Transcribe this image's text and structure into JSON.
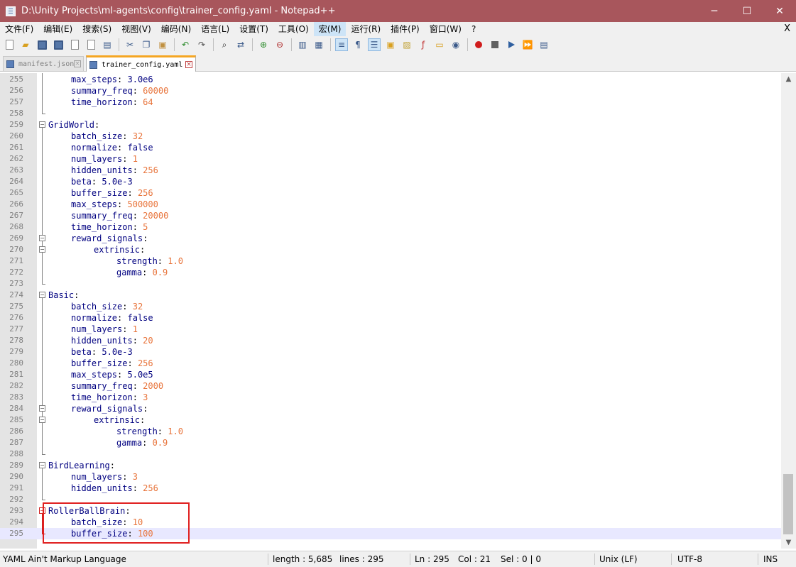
{
  "window": {
    "title": "D:\\Unity Projects\\ml-agents\\config\\trainer_config.yaml - Notepad++",
    "minimize": "─",
    "maximize": "☐",
    "close": "✕"
  },
  "menu": {
    "items": [
      "文件(F)",
      "编辑(E)",
      "搜索(S)",
      "视图(V)",
      "编码(N)",
      "语言(L)",
      "设置(T)",
      "工具(O)",
      "宏(M)",
      "运行(R)",
      "插件(P)",
      "窗口(W)",
      "?"
    ],
    "close_doc": "X"
  },
  "tabs": [
    {
      "label": "manifest.json",
      "active": false
    },
    {
      "label": "trainer_config.yaml",
      "active": true
    }
  ],
  "editor": {
    "lines": [
      {
        "n": "255",
        "indent": 1,
        "key": "max_steps",
        "val": "3.0e6",
        "vcolor": "key"
      },
      {
        "n": "256",
        "indent": 1,
        "key": "summary_freq",
        "val": "60000"
      },
      {
        "n": "257",
        "indent": 1,
        "key": "time_horizon",
        "val": "64"
      },
      {
        "n": "258",
        "indent": 0,
        "key": "",
        "val": ""
      },
      {
        "n": "259",
        "indent": 0,
        "key": "GridWorld",
        "val": ""
      },
      {
        "n": "260",
        "indent": 1,
        "key": "batch_size",
        "val": "32"
      },
      {
        "n": "261",
        "indent": 1,
        "key": "normalize",
        "val": "false",
        "vcolor": "key"
      },
      {
        "n": "262",
        "indent": 1,
        "key": "num_layers",
        "val": "1"
      },
      {
        "n": "263",
        "indent": 1,
        "key": "hidden_units",
        "val": "256"
      },
      {
        "n": "264",
        "indent": 1,
        "key": "beta",
        "val": "5.0e-3",
        "vcolor": "key"
      },
      {
        "n": "265",
        "indent": 1,
        "key": "buffer_size",
        "val": "256"
      },
      {
        "n": "266",
        "indent": 1,
        "key": "max_steps",
        "val": "500000"
      },
      {
        "n": "267",
        "indent": 1,
        "key": "summary_freq",
        "val": "20000"
      },
      {
        "n": "268",
        "indent": 1,
        "key": "time_horizon",
        "val": "5"
      },
      {
        "n": "269",
        "indent": 1,
        "key": "reward_signals",
        "val": ""
      },
      {
        "n": "270",
        "indent": 2,
        "key": "extrinsic",
        "val": ""
      },
      {
        "n": "271",
        "indent": 3,
        "key": "strength",
        "val": "1.0"
      },
      {
        "n": "272",
        "indent": 3,
        "key": "gamma",
        "val": "0.9"
      },
      {
        "n": "273",
        "indent": 0,
        "key": "",
        "val": ""
      },
      {
        "n": "274",
        "indent": 0,
        "key": "Basic",
        "val": ""
      },
      {
        "n": "275",
        "indent": 1,
        "key": "batch_size",
        "val": "32"
      },
      {
        "n": "276",
        "indent": 1,
        "key": "normalize",
        "val": "false",
        "vcolor": "key"
      },
      {
        "n": "277",
        "indent": 1,
        "key": "num_layers",
        "val": "1"
      },
      {
        "n": "278",
        "indent": 1,
        "key": "hidden_units",
        "val": "20"
      },
      {
        "n": "279",
        "indent": 1,
        "key": "beta",
        "val": "5.0e-3",
        "vcolor": "key"
      },
      {
        "n": "280",
        "indent": 1,
        "key": "buffer_size",
        "val": "256"
      },
      {
        "n": "281",
        "indent": 1,
        "key": "max_steps",
        "val": "5.0e5",
        "vcolor": "key"
      },
      {
        "n": "282",
        "indent": 1,
        "key": "summary_freq",
        "val": "2000"
      },
      {
        "n": "283",
        "indent": 1,
        "key": "time_horizon",
        "val": "3"
      },
      {
        "n": "284",
        "indent": 1,
        "key": "reward_signals",
        "val": ""
      },
      {
        "n": "285",
        "indent": 2,
        "key": "extrinsic",
        "val": ""
      },
      {
        "n": "286",
        "indent": 3,
        "key": "strength",
        "val": "1.0"
      },
      {
        "n": "287",
        "indent": 3,
        "key": "gamma",
        "val": "0.9"
      },
      {
        "n": "288",
        "indent": 0,
        "key": "",
        "val": ""
      },
      {
        "n": "289",
        "indent": 0,
        "key": "BirdLearning",
        "val": ""
      },
      {
        "n": "290",
        "indent": 1,
        "key": "num_layers",
        "val": "3"
      },
      {
        "n": "291",
        "indent": 1,
        "key": "hidden_units",
        "val": "256"
      },
      {
        "n": "292",
        "indent": 0,
        "key": "",
        "val": ""
      },
      {
        "n": "293",
        "indent": 0,
        "key": "RollerBallBrain",
        "val": ""
      },
      {
        "n": "294",
        "indent": 1,
        "key": "batch_size",
        "val": "10"
      },
      {
        "n": "295",
        "indent": 1,
        "key": "buffer_size",
        "val": "100",
        "current": true
      }
    ]
  },
  "status": {
    "language": "YAML Ain't Markup Language",
    "length": "length : 5,685",
    "lines": "lines : 295",
    "ln": "Ln : 295",
    "col": "Col : 21",
    "sel": "Sel : 0 | 0",
    "eol": "Unix (LF)",
    "encoding": "UTF-8",
    "mode": "INS"
  },
  "colors": {
    "titlebar": "#a8565c",
    "key": "#000080",
    "value": "#e8743b",
    "highlight": "#e02020"
  }
}
